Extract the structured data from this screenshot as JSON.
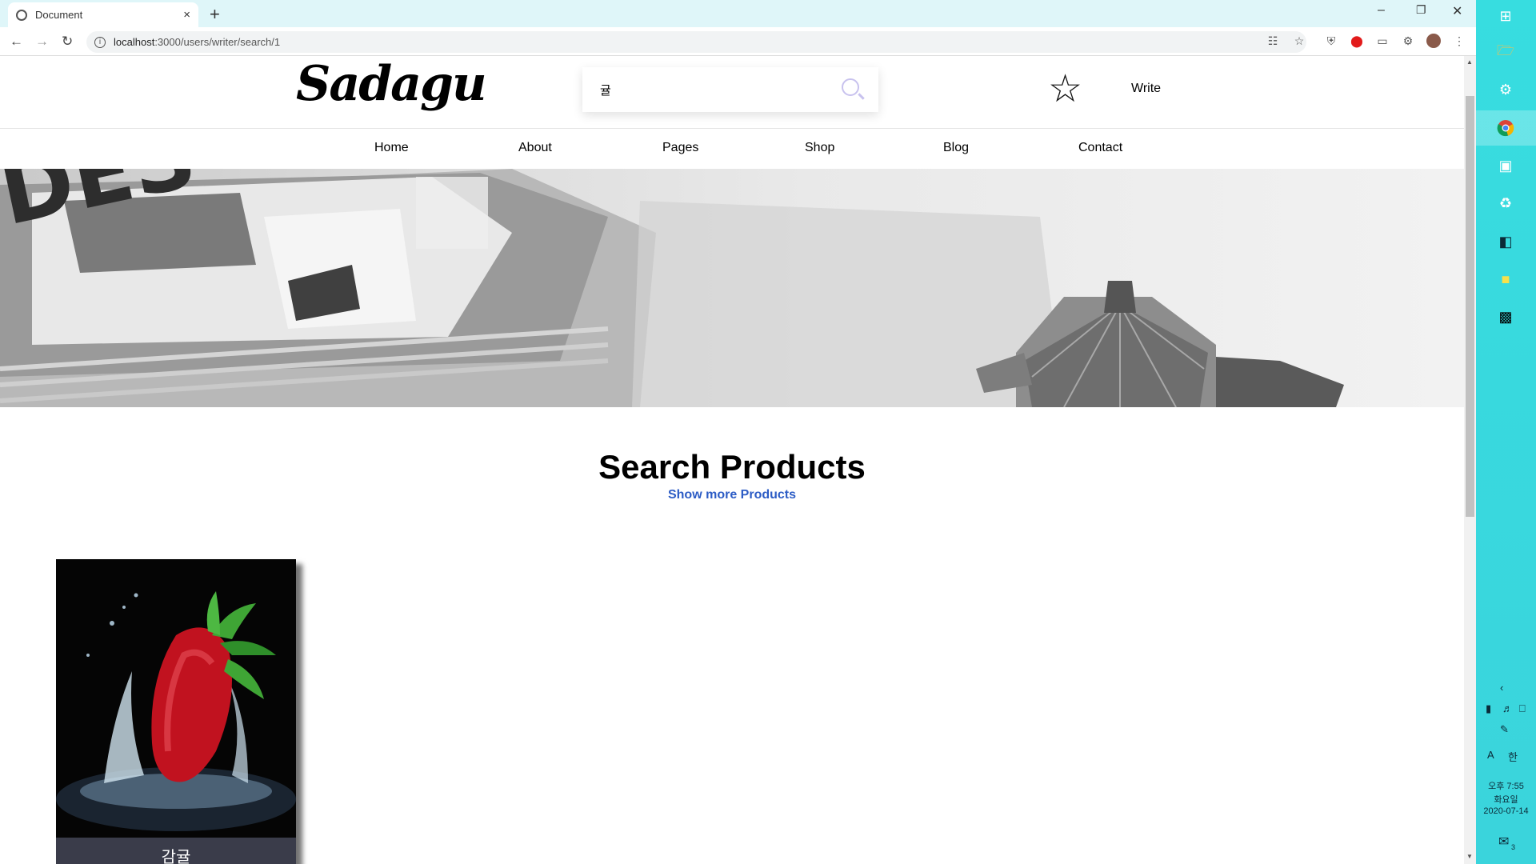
{
  "browser": {
    "tab_title": "Document",
    "tab_close": "×",
    "new_tab": "+",
    "url_host": "localhost",
    "url_path": ":3000/users/writer/search/1",
    "controls": {
      "minimize": "–",
      "restore": "❐",
      "close": "✕"
    }
  },
  "site": {
    "logo": "Sadagu",
    "search": {
      "value": "귤"
    },
    "write_label": "Write",
    "nav": [
      "Home",
      "About",
      "Pages",
      "Shop",
      "Blog",
      "Contact"
    ]
  },
  "section": {
    "title": "Search Products",
    "subtitle": "Show more Products"
  },
  "products": [
    {
      "name": "감귤"
    }
  ],
  "taskbar": {
    "time": "오후 7:55",
    "weekday": "화요일",
    "date": "2020-07-14",
    "ime_a": "A",
    "ime_lang": "한",
    "notifications": "3"
  }
}
